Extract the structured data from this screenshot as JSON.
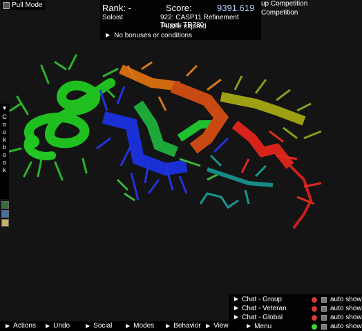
{
  "toolbar": {
    "pull_mode": "Pull Mode"
  },
  "header": {
    "rank": "Rank: -",
    "score_label": "Score:",
    "score_value": "9391.619",
    "mode": "Soloist",
    "puzzle": "922: CASP11 Refinement Target: TR780",
    "status": "Puzzle expired",
    "bonus": "No bonuses or conditions"
  },
  "competition": {
    "group": "up Competition",
    "all": "Competition"
  },
  "cookbook": {
    "letters": [
      "C",
      "o",
      "o",
      "k",
      "b",
      "o",
      "o",
      "k"
    ]
  },
  "chat": [
    {
      "label": "Chat - Group",
      "auto": "auto show",
      "dot": "#d23b3b"
    },
    {
      "label": "Chat - Veteran",
      "auto": "auto show",
      "dot": "#d23b3b"
    },
    {
      "label": "Chat - Global",
      "auto": "auto show",
      "dot": "#d23b3b"
    },
    {
      "label": "Menu",
      "auto": "auto show",
      "dot": "#36d436"
    }
  ],
  "bottom_menu": [
    "Actions",
    "Undo",
    "Social",
    "Modes",
    "Behavior",
    "View"
  ],
  "icons": [
    "cursor-icon",
    "expand-triangle-icon",
    "chat-toggle-icon",
    "autoshow-check-icon"
  ]
}
